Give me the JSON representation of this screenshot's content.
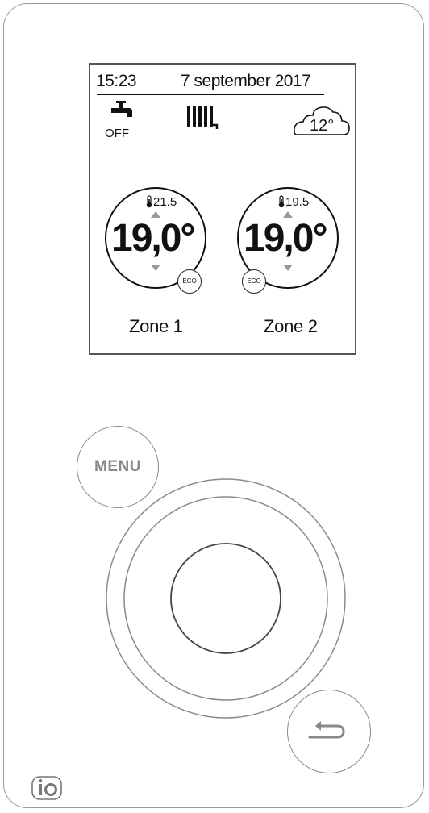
{
  "header": {
    "time": "15:23",
    "date": "7 september 2017"
  },
  "status": {
    "dhw_icon": "water-tap-icon",
    "dhw_state": "OFF",
    "heating_icon": "radiator-icon",
    "weather_icon": "cloud-icon",
    "outdoor_temperature": "12°"
  },
  "zones": [
    {
      "label": "Zone 1",
      "room_temperature": "21.5",
      "setpoint": "19,0°",
      "mode_badge": "ECO"
    },
    {
      "label": "Zone 2",
      "room_temperature": "19.5",
      "setpoint": "19,0°",
      "mode_badge": "ECO"
    }
  ],
  "controls": {
    "menu_label": "MENU",
    "back_icon": "back-arrow-icon",
    "dial": "rotary-dial",
    "logo_icon": "io-logo-icon"
  },
  "colors": {
    "display_ink": "#111111",
    "device_outline": "#9a9a9a",
    "button_outline": "#8a8a8a",
    "button_text": "#888888",
    "arrow_grey": "#999999"
  }
}
